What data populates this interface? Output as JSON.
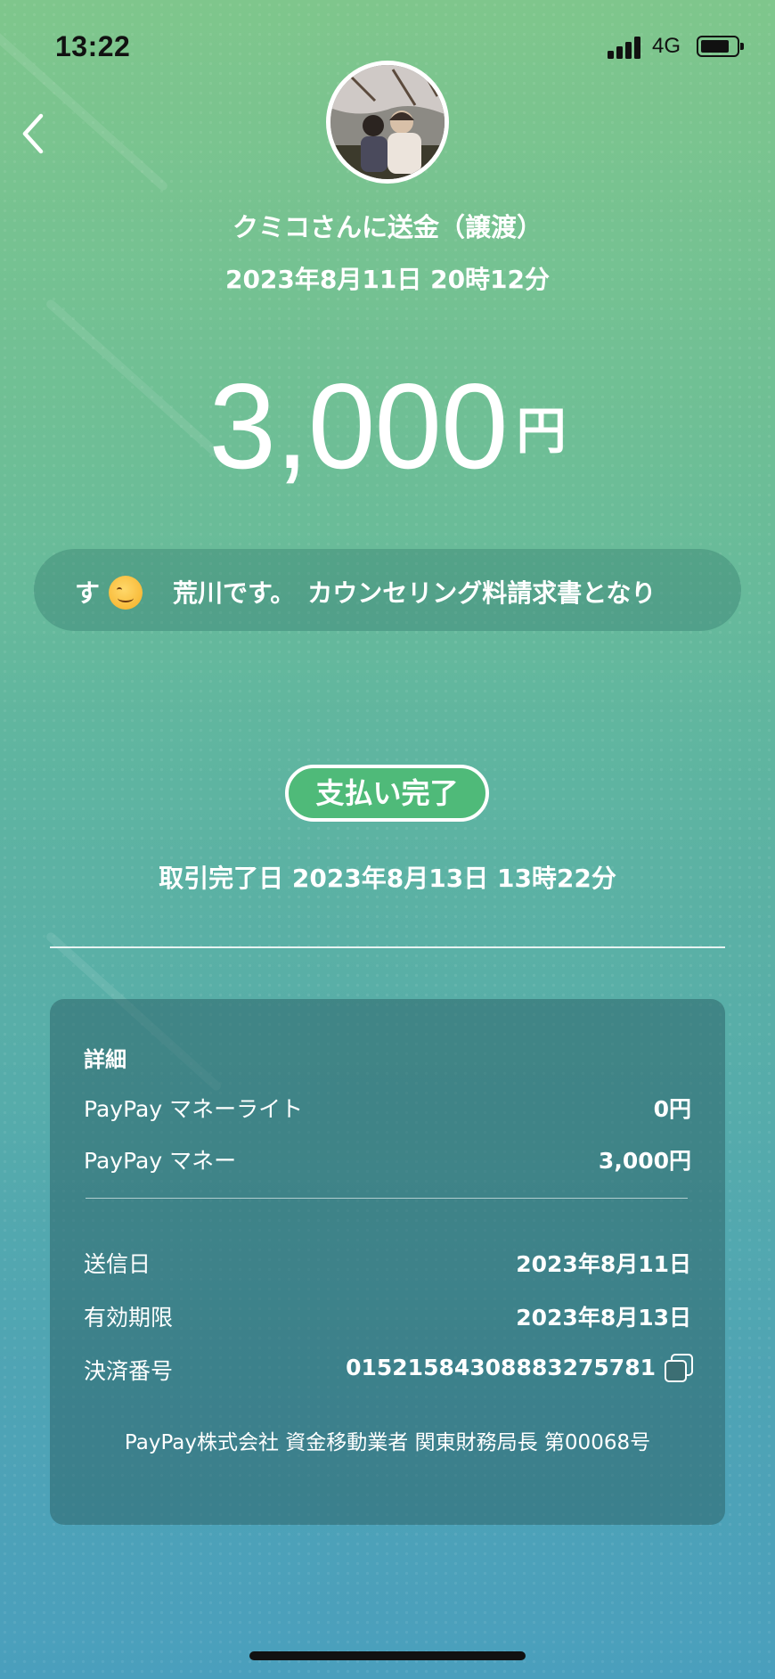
{
  "status_bar": {
    "time": "13:22",
    "network": "4G"
  },
  "header": {
    "title": "クミコさんに送金（譲渡）",
    "date": "2023年8月11日 20時12分"
  },
  "amount": {
    "value": "3,000",
    "unit": "円"
  },
  "message": {
    "text_prefix": "す",
    "text": "荒川です。　カウンセリング料請求書となり"
  },
  "status": {
    "badge": "支払い完了",
    "completed_label": "取引完了日 2023年8月13日 13時22分"
  },
  "details": {
    "title": "詳細",
    "rows": [
      {
        "label": "PayPay マネーライト",
        "value": "0円"
      },
      {
        "label": "PayPay マネー",
        "value": "3,000円"
      }
    ],
    "info": [
      {
        "label": "送信日",
        "value": "2023年8月11日"
      },
      {
        "label": "有効期限",
        "value": "2023年8月13日"
      },
      {
        "label": "決済番号",
        "value": "01521584308883275781"
      }
    ],
    "footer": "PayPay株式会社 資金移動業者 関東財務局長 第00068号"
  },
  "icons": {
    "back": "chevron-left-icon",
    "copy": "copy-icon"
  }
}
